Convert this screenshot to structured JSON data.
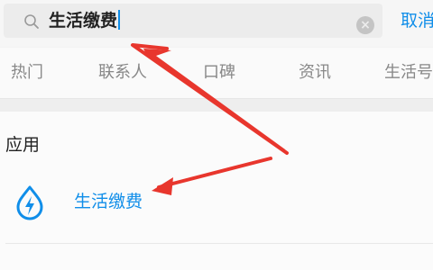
{
  "search": {
    "value": "生活缴费",
    "cancel_label": "取消"
  },
  "tabs": [
    {
      "label": "热门"
    },
    {
      "label": "联系人"
    },
    {
      "label": "口碑"
    },
    {
      "label": "资讯"
    },
    {
      "label": "生活号"
    }
  ],
  "section": {
    "title": "应用"
  },
  "results": [
    {
      "name": "生活缴费",
      "icon": "water-drop-lightning-icon"
    }
  ],
  "colors": {
    "accent": "#108ee9",
    "annotation_arrow": "#e8362d"
  }
}
